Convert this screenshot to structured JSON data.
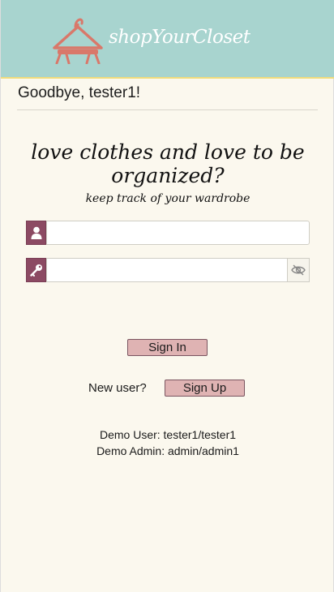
{
  "header": {
    "brand": "shopYourCloset",
    "logo_icon": "hanger-icon",
    "background_color": "#a8d4cf"
  },
  "greeting": "Goodbye, tester1!",
  "hero": {
    "tagline": "love clothes and love to be organized?",
    "subtagline": "keep track of your wardrobe"
  },
  "login_form": {
    "username_icon": "user-icon",
    "username_value": "",
    "password_icon": "key-icon",
    "password_value": "",
    "toggle_visibility_icon": "eye-slash-icon",
    "sign_in_label": "Sign In",
    "new_user_label": "New user?",
    "sign_up_label": "Sign Up"
  },
  "demo": {
    "user": "Demo User: tester1/tester1",
    "admin": "Demo Admin: admin/admin1"
  },
  "colors": {
    "accent": "#8c4a63",
    "button": "#dfb3b3",
    "page_background": "#fbf8ee"
  }
}
